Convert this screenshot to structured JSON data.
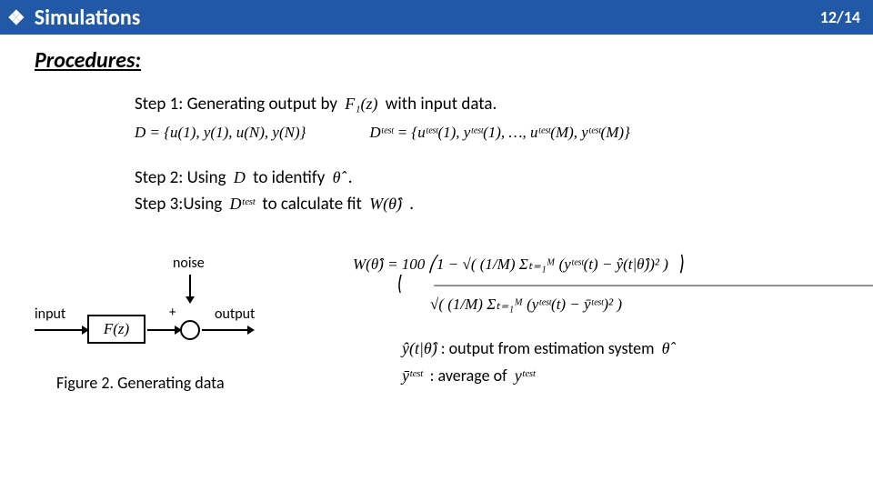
{
  "header": {
    "bullet": "❖",
    "title": "Simulations",
    "page": "12/14"
  },
  "section_heading": "Procedures:",
  "steps": {
    "s1a": "Step 1: Generating output by ",
    "s1m": "F₁(z)",
    "s1b": " with input data.",
    "eqD": "D = {u(1), y(1), u(N), y(N)}",
    "eqDtest": "Dᵗᵉˢᵗ = {uᵗᵉˢᵗ(1), yᵗᵉˢᵗ(1), …, uᵗᵉˢᵗ(M), yᵗᵉˢᵗ(M)}",
    "s2a": "Step 2: Using ",
    "s2m1": "D",
    "s2b": " to identify ",
    "s2m2": "θ̂",
    "s2c": " .",
    "s3a": "Step 3:Using ",
    "s3m1": "Dᵗᵉˢᵗ",
    "s3b": " to calculate fit ",
    "s3m2": "W(θ̂)",
    "s3c": " ."
  },
  "diagram": {
    "noise": "noise",
    "input": "input",
    "block": "F(z)",
    "plus": "+",
    "output": "output"
  },
  "figure_caption": "Figure 2. Generating data",
  "formula": "W(θ̂) = 100 ⎛1 − √( (1/M) Σₜ₌₁ᴹ (yᵗᵉˢᵗ(t) − ŷ(t|θ̂))² )  ⎞\n           ⎝        ――――――――――――――――――――――――――――――  ⎠\n                    √( (1/M) Σₜ₌₁ᴹ (yᵗᵉˢᵗ(t) − ȳᵗᵉˢᵗ)² )",
  "legend": {
    "l1a": "ŷ(t|θ̂)",
    "l1b": ": output from estimation system ",
    "l1c": "θ̂",
    "l2a": "ȳᵗᵉˢᵗ",
    "l2b": " : average of ",
    "l2c": "yᵗᵉˢᵗ"
  }
}
